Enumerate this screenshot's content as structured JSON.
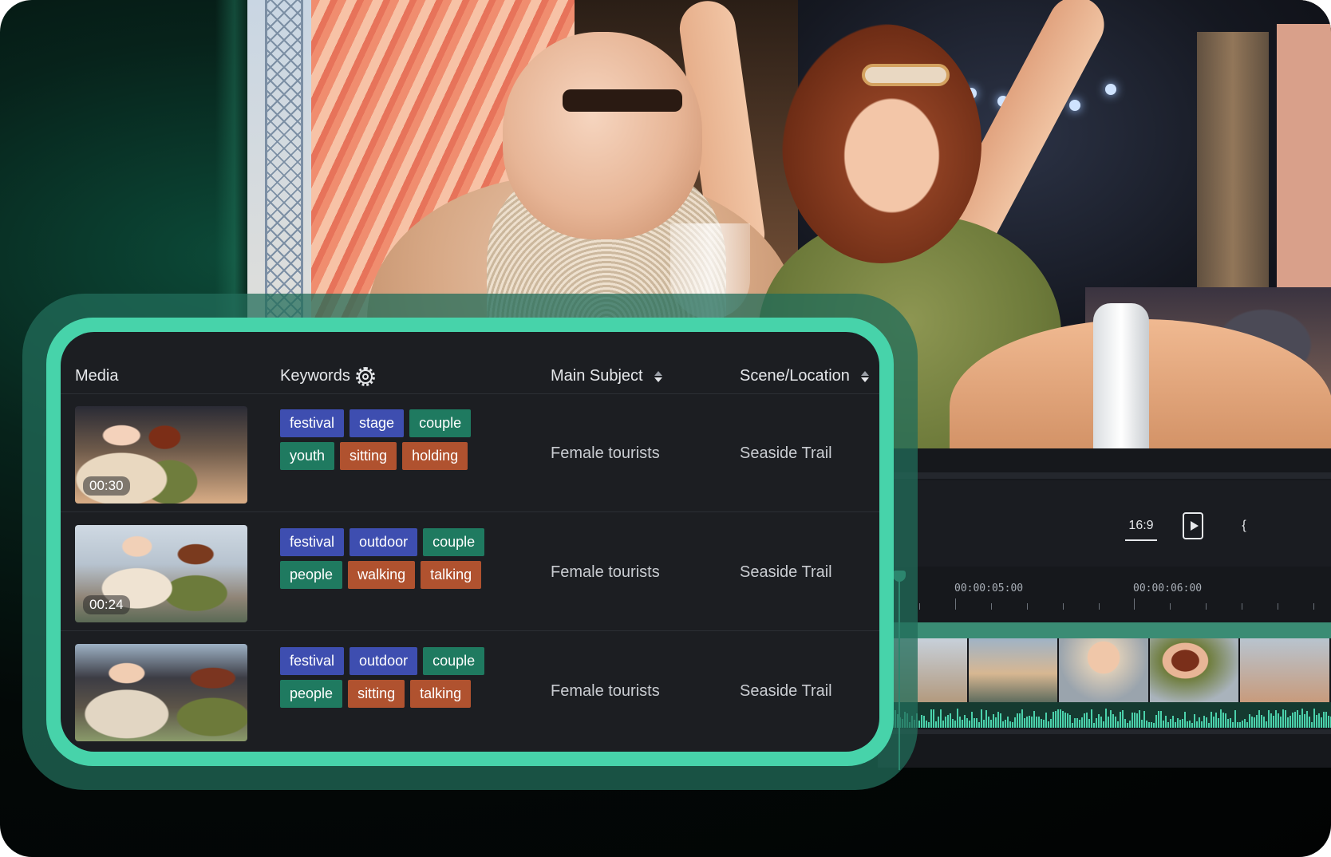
{
  "table": {
    "headers": {
      "media": "Media",
      "keywords": "Keywords",
      "main_subject": "Main Subject",
      "scene_location": "Scene/Location"
    },
    "rows": [
      {
        "duration": "00:30",
        "keywords": [
          {
            "label": "festival",
            "color": "#3e4eb0"
          },
          {
            "label": "stage",
            "color": "#3e4eb0"
          },
          {
            "label": "couple",
            "color": "#1f7a60"
          },
          {
            "label": "youth",
            "color": "#1f7a60"
          },
          {
            "label": "sitting",
            "color": "#b0522f"
          },
          {
            "label": "holding",
            "color": "#b0522f"
          }
        ],
        "main_subject": "Female tourists",
        "scene_location": "Seaside Trail"
      },
      {
        "duration": "00:24",
        "keywords": [
          {
            "label": "festival",
            "color": "#3e4eb0"
          },
          {
            "label": "outdoor",
            "color": "#3e4eb0"
          },
          {
            "label": "couple",
            "color": "#1f7a60"
          },
          {
            "label": "people",
            "color": "#1f7a60"
          },
          {
            "label": "walking",
            "color": "#b0522f"
          },
          {
            "label": "talking",
            "color": "#b0522f"
          }
        ],
        "main_subject": "Female tourists",
        "scene_location": "Seaside Trail"
      },
      {
        "duration": "",
        "keywords": [
          {
            "label": "festival",
            "color": "#3e4eb0"
          },
          {
            "label": "outdoor",
            "color": "#3e4eb0"
          },
          {
            "label": "couple",
            "color": "#1f7a60"
          },
          {
            "label": "people",
            "color": "#1f7a60"
          },
          {
            "label": "sitting",
            "color": "#b0522f"
          },
          {
            "label": "talking",
            "color": "#b0522f"
          }
        ],
        "main_subject": "Female tourists",
        "scene_location": "Seaside Trail"
      }
    ]
  },
  "editor": {
    "aspect_ratio": "16:9",
    "timecodes": [
      "00:00:05:00",
      "00:00:06:00"
    ]
  },
  "icons": {
    "keywords_settings": "gear-icon",
    "sort": "sort-icon",
    "preview": "play-icon",
    "brace": "brace-icon"
  },
  "colors": {
    "accent": "#47d3aa",
    "card_background": "#1c1e22",
    "tag_blue": "#3e4eb0",
    "tag_green": "#1f7a60",
    "tag_orange": "#b0522f"
  }
}
